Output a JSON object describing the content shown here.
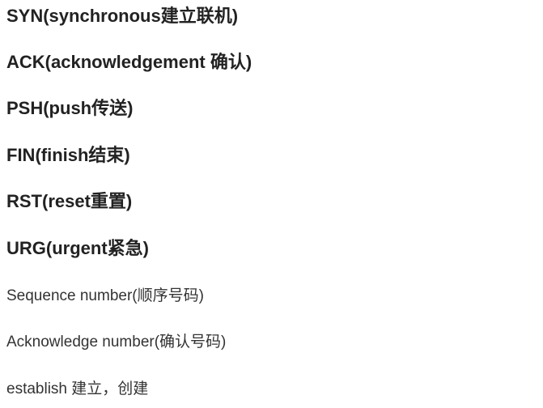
{
  "headings": [
    "SYN(synchronous建立联机)",
    "ACK(acknowledgement 确认)",
    "PSH(push传送)",
    "FIN(finish结束)",
    "RST(reset重置)",
    "URG(urgent紧急)"
  ],
  "paragraphs": [
    "Sequence number(顺序号码)",
    "Acknowledge number(确认号码)",
    "establish 建立，创建"
  ]
}
